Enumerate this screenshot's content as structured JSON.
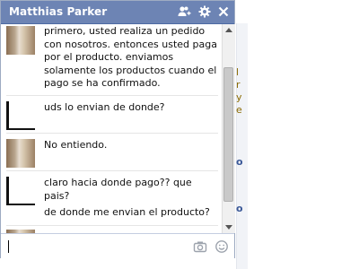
{
  "chat": {
    "title": "Matthias Parker",
    "icons": {
      "add_friends": "add-friends-icon",
      "settings": "gear-icon",
      "close": "close-icon"
    },
    "messages": [
      {
        "sender": "photo",
        "text": "primero, usted realiza un pedido con nosotros. entonces usted paga por el producto. enviamos solamente los productos cuando el pago se ha confirmado."
      },
      {
        "sender": "blank",
        "text": "uds lo envian de donde?"
      },
      {
        "sender": "photo",
        "text": "No entiendo."
      },
      {
        "sender": "blank",
        "text": "claro hacia donde pago?? que pais?"
      },
      {
        "sender": "blank",
        "text": "de donde me envian el producto?"
      }
    ],
    "input": {
      "value": "",
      "camera_icon": "camera-icon",
      "emoji_icon": "smiley-icon"
    }
  },
  "background": {
    "letters": [
      "l",
      "r",
      "y",
      "e",
      "o",
      "o"
    ]
  },
  "colors": {
    "titlebar": "#6d84b4",
    "border": "#9eabc2"
  }
}
